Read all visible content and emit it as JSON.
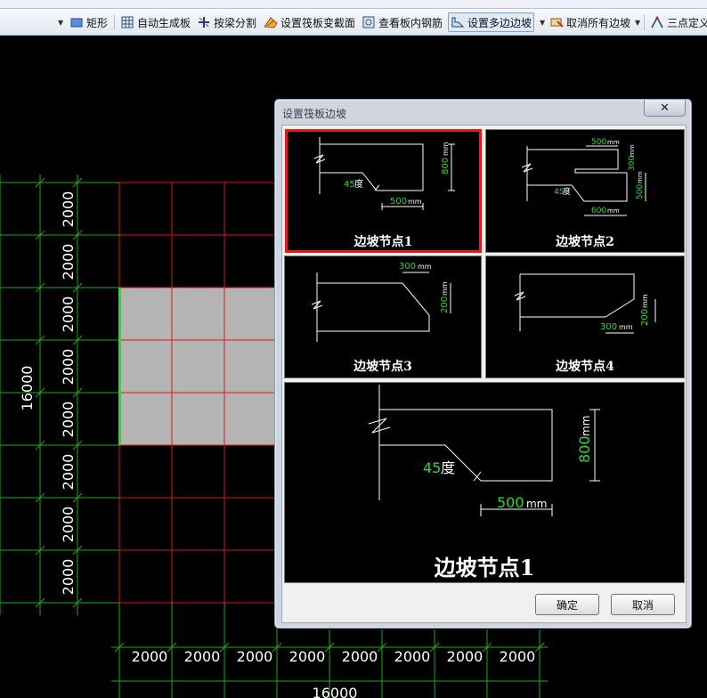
{
  "toolbar": {
    "items": [
      {
        "label": "矩形",
        "icon": "rectangle-icon"
      },
      {
        "label": "自动生成板",
        "icon": "grid-icon"
      },
      {
        "label": "按梁分割",
        "icon": "split-icon"
      },
      {
        "label": "设置筏板变截面",
        "icon": "section-icon"
      },
      {
        "label": "查看板内钢筋",
        "icon": "rebar-view-icon"
      },
      {
        "label": "设置多边边坡",
        "icon": "slope-icon"
      },
      {
        "label": "取消所有边坡",
        "icon": "cancel-slope-icon"
      },
      {
        "label": "三点定义",
        "icon": "three-point-icon"
      }
    ]
  },
  "canvas": {
    "row_labels": [
      "2000",
      "2000",
      "2000",
      "2000",
      "2000",
      "2000",
      "2000",
      "2000"
    ],
    "col_labels": [
      "2000",
      "2000",
      "2000",
      "2000",
      "2000",
      "2000",
      "2000",
      "2000"
    ],
    "total_vertical": "16000",
    "total_horizontal": "16000"
  },
  "dialog": {
    "title": "设置筏板边坡",
    "close": "✕",
    "nodes": [
      {
        "label": "边坡节点1",
        "dims": [
          "45度",
          "500mm",
          "800mm"
        ]
      },
      {
        "label": "边坡节点2",
        "dims": [
          "500mm",
          "300mm",
          "500mm",
          "45度",
          "600mm"
        ]
      },
      {
        "label": "边坡节点3",
        "dims": [
          "300mm",
          "200mm"
        ]
      },
      {
        "label": "边坡节点4",
        "dims": [
          "300mm",
          "200mm"
        ]
      }
    ],
    "preview": {
      "label": "边坡节点1",
      "angle_value": "45",
      "angle_unit": "度",
      "width_value": "500",
      "width_unit": "mm",
      "height_value": "800",
      "height_unit": "mm"
    },
    "ok_label": "确定",
    "cancel_label": "取消"
  },
  "colors": {
    "grid_green": "#1fa81f",
    "grid_red": "#d81818",
    "selected_fill": "#b4b4b4",
    "edge_highlight": "#22e022",
    "dim_green": "#30d830",
    "select_border": "#e21b1b"
  }
}
